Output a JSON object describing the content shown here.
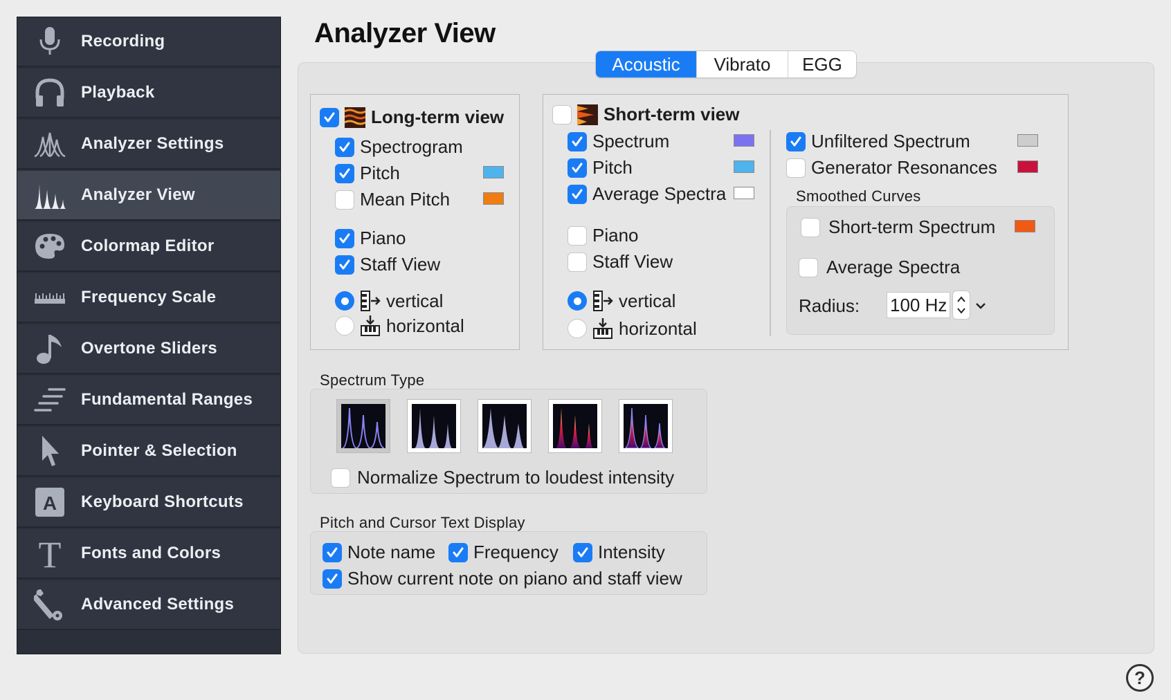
{
  "sidebar": {
    "items": [
      {
        "label": "Recording",
        "icon": "microphone-icon",
        "active": false
      },
      {
        "label": "Playback",
        "icon": "headphones-icon",
        "active": false
      },
      {
        "label": "Analyzer Settings",
        "icon": "analyzer-settings-icon",
        "active": false
      },
      {
        "label": "Analyzer View",
        "icon": "analyzer-view-icon",
        "active": true
      },
      {
        "label": "Colormap Editor",
        "icon": "palette-icon",
        "active": false
      },
      {
        "label": "Frequency Scale",
        "icon": "ruler-icon",
        "active": false
      },
      {
        "label": "Overtone Sliders",
        "icon": "music-note-icon",
        "active": false
      },
      {
        "label": "Fundamental Ranges",
        "icon": "ranges-icon",
        "active": false
      },
      {
        "label": "Pointer & Selection",
        "icon": "pointer-icon",
        "active": false
      },
      {
        "label": "Keyboard Shortcuts",
        "icon": "keyboard-a-icon",
        "active": false
      },
      {
        "label": "Fonts and Colors",
        "icon": "font-t-icon",
        "active": false
      },
      {
        "label": "Advanced Settings",
        "icon": "wrench-icon",
        "active": false
      }
    ]
  },
  "page": {
    "title": "Analyzer View"
  },
  "tabs": [
    {
      "label": "Acoustic",
      "active": true
    },
    {
      "label": "Vibrato",
      "active": false
    },
    {
      "label": "EGG",
      "active": false
    }
  ],
  "long_term": {
    "title": "Long-term view",
    "enabled": true,
    "spectrogram": "Spectrogram",
    "pitch": "Pitch",
    "mean_pitch": "Mean Pitch",
    "piano": "Piano",
    "staff_view": "Staff View",
    "vertical": "vertical",
    "horizontal": "horizontal",
    "pitch_color": "#4fb3ee",
    "mean_pitch_color": "#f07d12"
  },
  "short_term": {
    "title": "Short-term view",
    "enabled": false,
    "spectrum": "Spectrum",
    "pitch": "Pitch",
    "average_spectra": "Average Spectra",
    "piano": "Piano",
    "staff_view": "Staff View",
    "vertical": "vertical",
    "horizontal": "horizontal",
    "unfiltered_spectrum": "Unfiltered Spectrum",
    "generator_resonances": "Generator Resonances",
    "smoothed_curves": "Smoothed Curves",
    "short_term_spectrum": "Short-term Spectrum",
    "smoothed_average_spectra": "Average Spectra",
    "radius_label": "Radius:",
    "radius_value": "100 Hz",
    "spectrum_color": "#7b72f2",
    "pitch_color": "#4fb3ee",
    "average_spectra_color": "#ffffff",
    "unfiltered_color": "#cdcdcd",
    "generator_color": "#c8123e",
    "short_term_spectrum_color": "#f05a14"
  },
  "spectrum_type": {
    "label": "Spectrum Type",
    "normalize": "Normalize Spectrum to loudest intensity"
  },
  "pitch_cursor": {
    "label": "Pitch and Cursor Text Display",
    "note_name": "Note name",
    "frequency": "Frequency",
    "intensity": "Intensity",
    "show_current_note": "Show current note on piano and staff view"
  },
  "help": {
    "label": "?"
  }
}
